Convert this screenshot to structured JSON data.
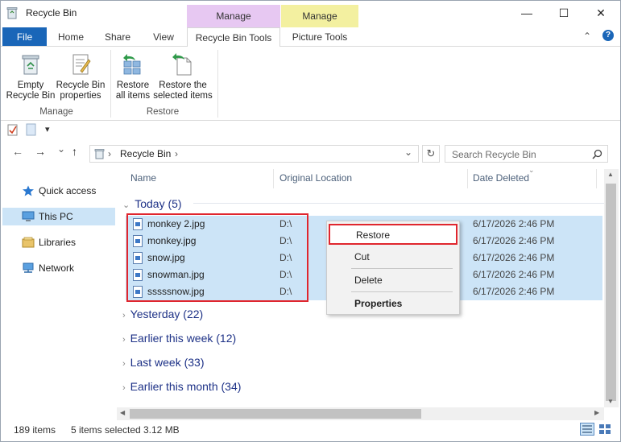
{
  "window": {
    "title": "Recycle Bin",
    "minimize": "—",
    "maximize": "☐",
    "close": "✕",
    "collapse": "⌃",
    "help": "?"
  },
  "contextual_headers": {
    "manage_1": "Manage",
    "manage_2": "Manage"
  },
  "tabs": [
    "File",
    "Home",
    "Share",
    "View",
    "Recycle Bin Tools",
    "Picture Tools"
  ],
  "ribbon": {
    "empty_line1": "Empty",
    "empty_line2": "Recycle Bin",
    "props_line1": "Recycle Bin",
    "props_line2": "properties",
    "restore_all_line1": "Restore",
    "restore_all_line2": "all items",
    "restore_sel_line1": "Restore the",
    "restore_sel_line2": "selected items",
    "group_manage": "Manage",
    "group_restore": "Restore"
  },
  "qat": {
    "dropdown": "▾"
  },
  "address": {
    "back": "←",
    "forward": "→",
    "recent": "⌄",
    "up": "↑",
    "path": "Recycle Bin",
    "path_chevron": "›",
    "refresh": "↻",
    "search_placeholder": "Search Recycle Bin"
  },
  "nav": [
    {
      "label": "Quick access",
      "icon": "star-icon"
    },
    {
      "label": "This PC",
      "icon": "computer-icon"
    },
    {
      "label": "Libraries",
      "icon": "libraries-icon"
    },
    {
      "label": "Network",
      "icon": "network-icon"
    }
  ],
  "columns": [
    "Name",
    "Original Location",
    "Date Deleted"
  ],
  "groups": [
    {
      "label": "Today (5)",
      "expanded": true
    },
    {
      "label": "Yesterday (22)",
      "expanded": false
    },
    {
      "label": "Earlier this week (12)",
      "expanded": false
    },
    {
      "label": "Last week (33)",
      "expanded": false
    },
    {
      "label": "Earlier this month (34)",
      "expanded": false
    }
  ],
  "files": [
    {
      "name": "monkey 2.jpg",
      "location": "D:\\",
      "date": "6/17/2026 2:46 PM"
    },
    {
      "name": "monkey.jpg",
      "location": "D:\\",
      "date": "6/17/2026 2:46 PM"
    },
    {
      "name": "snow.jpg",
      "location": "D:\\",
      "date": "6/17/2026 2:46 PM"
    },
    {
      "name": "snowman.jpg",
      "location": "D:\\",
      "date": "6/17/2026 2:46 PM"
    },
    {
      "name": "sssssnow.jpg",
      "location": "D:\\",
      "date": "6/17/2026 2:46 PM"
    }
  ],
  "context_menu": [
    "Restore",
    "Cut",
    "Delete",
    "Properties"
  ],
  "status": {
    "items": "189 items",
    "selected": "5 items selected",
    "size": "3.12 MB"
  },
  "colors": {
    "accent": "#1a66b8",
    "selection": "#cce4f7",
    "highlight": "#e0262e",
    "manage_tab": "#e7c8f2",
    "picture_tab": "#f3f0a0"
  }
}
